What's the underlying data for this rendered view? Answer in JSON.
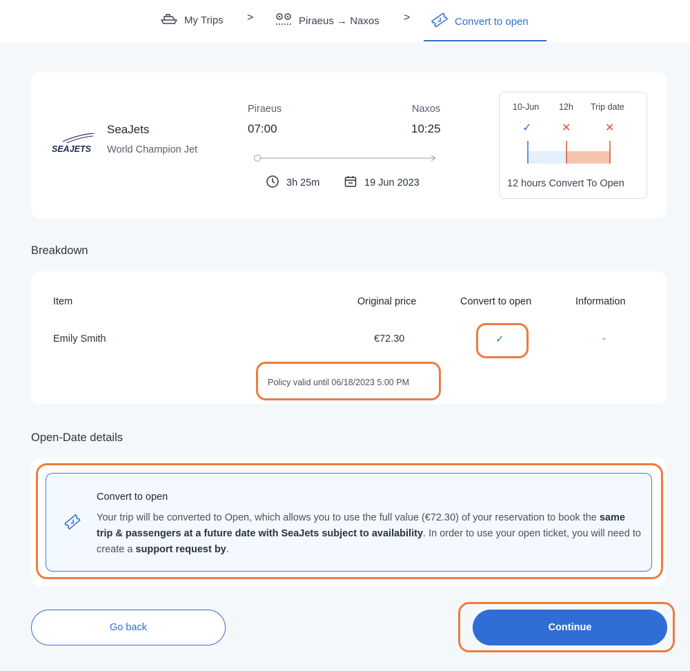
{
  "breadcrumb": {
    "items": [
      {
        "label": "My Trips",
        "icon": "ship-icon"
      },
      {
        "label": "Piraeus → Naxos",
        "icon": "route-pin-icon"
      },
      {
        "label": "Convert to open",
        "icon": "ticket-icon"
      }
    ],
    "separator": ">"
  },
  "trip": {
    "operator": "SeaJets",
    "logo_text": "SEAJETS",
    "vessel": "World Champion Jet",
    "from_port": "Piraeus",
    "from_time": "07:00",
    "to_port": "Naxos",
    "to_time": "10:25",
    "duration": "3h 25m",
    "date": "19 Jun 2023"
  },
  "policy_timeline": {
    "labels": [
      "10-Jun",
      "12h",
      "Trip date"
    ],
    "marks": [
      "✓",
      "✕",
      "✕"
    ],
    "caption": "12 hours Convert To Open"
  },
  "breakdown": {
    "title": "Breakdown",
    "headers": [
      "Item",
      "Original price",
      "Convert to open",
      "Information"
    ],
    "rows": [
      {
        "item": "Emily Smith",
        "price": "€72.30",
        "convert": "✓",
        "information": "-"
      }
    ],
    "policy_note": "Policy valid until 06/18/2023 5:00 PM"
  },
  "open_date": {
    "title": "Open-Date details",
    "box_title": "Convert to open",
    "text_1": "Your trip will be converted to Open, which allows you to use the full value (€72.30) of your reservation to book the ",
    "text_bold_1": "same trip & passengers at a future date with SeaJets subject to availability",
    "text_2": ". In order to use your open ticket, you will need to create a ",
    "text_bold_2": "support request by",
    "text_3": "."
  },
  "actions": {
    "back_label": "Go back",
    "continue_label": "Continue"
  },
  "colors": {
    "accent": "#2f6ed4",
    "highlight": "#ec7c3f",
    "danger": "#d1553d",
    "success": "#2a8f48"
  }
}
